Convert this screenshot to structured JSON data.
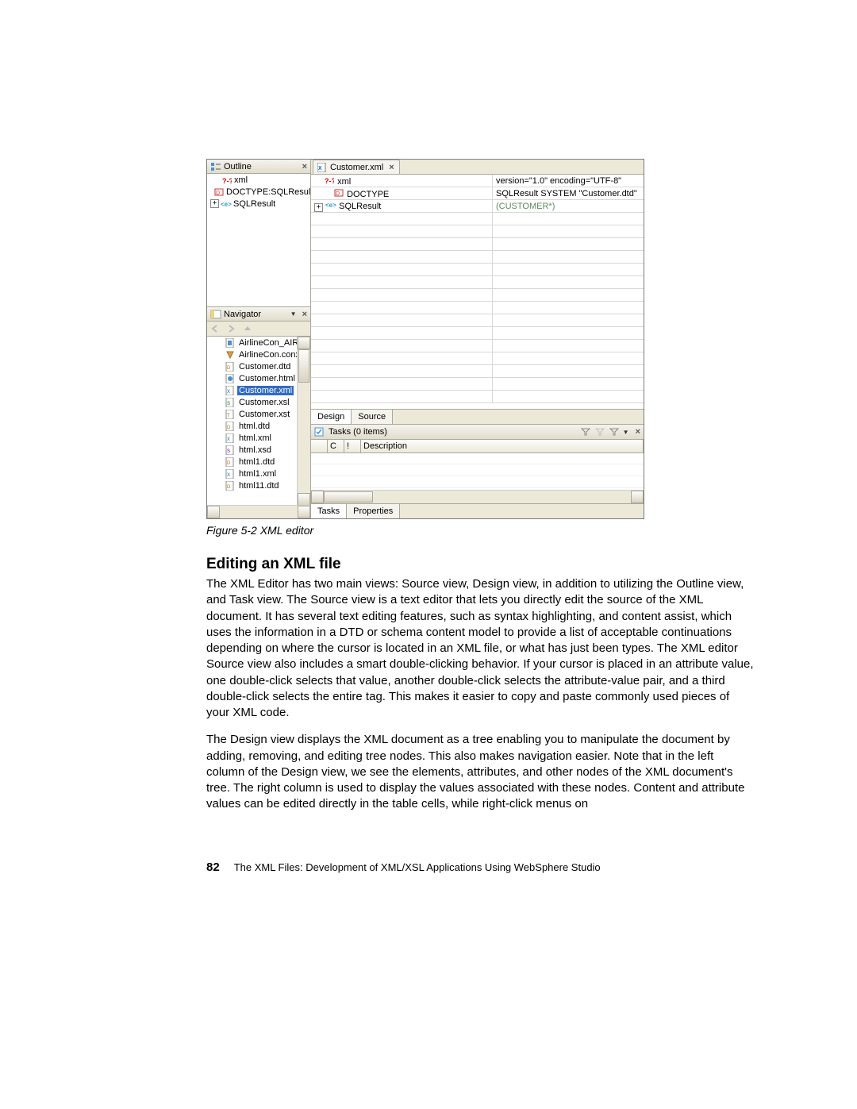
{
  "outline": {
    "title": "Outline",
    "nodes": [
      {
        "indent": 0,
        "icon": "pi",
        "label": "xml"
      },
      {
        "indent": 1,
        "icon": "doctype",
        "label": "DOCTYPE:SQLResult"
      },
      {
        "indent": 0,
        "icon": "elem",
        "expand": "+",
        "label": "SQLResult"
      }
    ]
  },
  "navigator": {
    "title": "Navigator",
    "files": [
      {
        "icon": "sql",
        "label": "AirlineCon_AIRLINE."
      },
      {
        "icon": "con",
        "label": "AirlineCon.conxmi"
      },
      {
        "icon": "dtd",
        "label": "Customer.dtd"
      },
      {
        "icon": "html",
        "label": "Customer.html"
      },
      {
        "icon": "xml",
        "label": "Customer.xml",
        "selected": true
      },
      {
        "icon": "xsl",
        "label": "Customer.xsl"
      },
      {
        "icon": "xst",
        "label": "Customer.xst"
      },
      {
        "icon": "dtd",
        "label": "html.dtd"
      },
      {
        "icon": "xml",
        "label": "html.xml"
      },
      {
        "icon": "xsd",
        "label": "html.xsd"
      },
      {
        "icon": "dtd",
        "label": "html1.dtd"
      },
      {
        "icon": "xml",
        "label": "html1.xml"
      },
      {
        "icon": "dtd",
        "label": "html11.dtd"
      }
    ]
  },
  "editor": {
    "tab_label": "Customer.xml",
    "rows": [
      {
        "indent": 0,
        "icon": "pi",
        "left": "xml",
        "right": "version=\"1.0\" encoding=\"UTF-8\""
      },
      {
        "indent": 1,
        "icon": "doctype",
        "left": "DOCTYPE",
        "right": "SQLResult SYSTEM \"Customer.dtd\""
      },
      {
        "indent": 0,
        "icon": "elem",
        "expand": "+",
        "left": "SQLResult",
        "right": "(CUSTOMER*)",
        "rightDim": true
      }
    ],
    "bottom_tabs": {
      "design": "Design",
      "source": "Source",
      "active": "design"
    }
  },
  "tasks": {
    "title": "Tasks (0 items)",
    "columns": {
      "c": "C",
      "i": "!",
      "desc": "Description"
    },
    "bottom_tabs": {
      "tasks": "Tasks",
      "properties": "Properties",
      "active": "tasks"
    }
  },
  "caption": "Figure 5-2   XML editor",
  "section_heading": "Editing an XML file",
  "para1": "The XML Editor has two main views: Source view, Design view, in addition to utilizing the Outline view, and Task view. The Source view is a text editor that lets you directly edit the source of the XML document. It has several text editing features, such as syntax highlighting, and content assist, which uses the information in a DTD or schema content model to provide a list of acceptable continuations depending on where the cursor is located in an XML file, or what has just been types. The XML editor Source view also includes a smart double-clicking behavior. If your cursor is placed in an attribute value, one double-click selects that value, another double-click selects the attribute-value pair, and a third double-click selects the entire tag. This makes it easier to copy and paste commonly used pieces of your XML code.",
  "para2": "The Design view displays the XML document as a tree enabling you to manipulate the document by adding, removing, and editing tree nodes. This also makes navigation easier. Note that in the left column of the Design view, we see the elements, attributes, and other nodes of the XML document's tree. The right column is used to display the values associated with these nodes. Content and attribute values can be edited directly in the table cells, while right-click menus on",
  "footer": {
    "page": "82",
    "title": "The XML Files:   Development of XML/XSL Applications Using WebSphere Studio"
  },
  "icons": {
    "pi": "<svg width='12' height='10'><text x='0' y='9' font-size='9' fill='#c00' font-weight='bold'>?-?</text></svg>",
    "doctype": "<svg width='12' height='10'><rect x='1' y='1' width='10' height='8' fill='#fff' stroke='#c33'/><text x='2' y='8' font-size='7' fill='#c33'>D</text></svg>",
    "elem": "<svg width='14' height='10'><text x='0' y='8' font-size='8' fill='#39c' font-weight='bold'>&lt;e&gt;</text></svg>",
    "xml": "<svg width='12' height='12'><rect x='1' y='0' width='9' height='12' fill='#fff' stroke='#888'/><text x='2' y='9' font-size='6' fill='#06c'>X</text></svg>",
    "dtd": "<svg width='12' height='12'><rect x='1' y='0' width='9' height='12' fill='#fff' stroke='#888'/><text x='2' y='9' font-size='6' fill='#c60'>D</text></svg>",
    "xsl": "<svg width='12' height='12'><rect x='1' y='0' width='9' height='12' fill='#fff' stroke='#888'/><text x='2' y='9' font-size='6' fill='#070'>S</text></svg>",
    "xst": "<svg width='12' height='12'><rect x='1' y='0' width='9' height='12' fill='#fff' stroke='#888'/><text x='2' y='9' font-size='6' fill='#770'>T</text></svg>",
    "xsd": "<svg width='12' height='12'><rect x='1' y='0' width='9' height='12' fill='#fff' stroke='#888'/><text x='2' y='9' font-size='6' fill='#609'>S</text></svg>",
    "html": "<svg width='12' height='12'><rect x='1' y='0' width='9' height='12' fill='#fff' stroke='#888'/><circle cx='6' cy='6' r='3' fill='#4a90d9'/></svg>",
    "sql": "<svg width='12' height='12'><rect x='1' y='0' width='9' height='12' fill='#fff' stroke='#888'/><rect x='3' y='3' width='5' height='6' fill='#4a90d9'/></svg>",
    "con": "<svg width='12' height='12'><path d='M2 2 L10 2 L6 10 Z' fill='#d9a24a' stroke='#a07020'/></svg>",
    "outline": "<svg width='14' height='12'><rect x='1' y='1' width='4' height='4' fill='#4a90d9'/><rect x='1' y='7' width='4' height='4' fill='#4a90d9'/><line x1='7' y1='3' x2='13' y2='3' stroke='#555'/><line x1='7' y1='9' x2='13' y2='9' stroke='#555'/></svg>",
    "navigator": "<svg width='14' height='12'><rect x='1' y='1' width='12' height='10' fill='#fff' stroke='#999'/><rect x='1' y='1' width='4' height='10' fill='#f3d47a'/></svg>",
    "tasks": "<svg width='14' height='12'><rect x='1' y='1' width='10' height='10' fill='#fff' stroke='#4a90d9'/><path d='M3 6 L5 8 L9 3' stroke='#4a90d9' fill='none' stroke-width='1.5'/></svg>",
    "back": "<svg width='12' height='10'><path d='M7 1 L2 5 L7 9' fill='none' stroke='#bbb' stroke-width='2'/></svg>",
    "fwd": "<svg width='12' height='10'><path d='M3 1 L8 5 L3 9' fill='none' stroke='#bbb' stroke-width='2'/></svg>",
    "up": "<svg width='12' height='10'><path d='M6 2 L10 7 L2 7 Z' fill='#bbb'/></svg>",
    "filter": "<svg width='12' height='10'><path d='M1 1 L11 1 L7 5 L7 9 L5 9 L5 5 Z' fill='none' stroke='#888'/></svg>",
    "xdoc": "<svg width='12' height='12'><rect x='0' y='0' width='10' height='12' fill='#fff' stroke='#777'/><text x='1' y='9' font-size='7' fill='#06c' font-weight='bold'>X</text></svg>"
  }
}
